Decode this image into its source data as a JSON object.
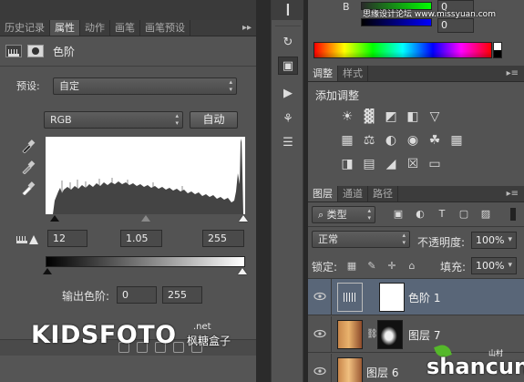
{
  "properties_panel": {
    "tabs": [
      "历史记录",
      "属性",
      "动作",
      "画笔",
      "画笔预设"
    ],
    "active_tab": "属性",
    "tab_overflow": "▸▸",
    "adjustment_title": "色阶",
    "preset_label": "预设:",
    "preset_value": "自定",
    "channel_value": "RGB",
    "auto_button": "自动",
    "input_black": "12",
    "input_gamma": "1.05",
    "input_white": "255",
    "output_label": "输出色阶:",
    "output_black": "0",
    "output_white": "255"
  },
  "color_panel": {
    "row_b_label": "B",
    "row_g_value": "0",
    "row_b_value": "0"
  },
  "adjustments_panel": {
    "tabs": [
      "调整",
      "样式"
    ],
    "title": "添加调整"
  },
  "layers_panel": {
    "tabs": [
      "图层",
      "通道",
      "路径"
    ],
    "filter_kind": "类型",
    "blend_mode": "正常",
    "opacity_label": "不透明度:",
    "opacity_value": "100%",
    "lock_label": "锁定:",
    "fill_label": "填充:",
    "fill_value": "100%",
    "layers": [
      {
        "name": "色阶 1",
        "selected": true
      },
      {
        "name": "图层 7",
        "selected": false
      },
      {
        "name": "图层 6",
        "selected": false
      }
    ]
  },
  "watermarks": {
    "kidsfoto": "KIDSFOTO",
    "kidsfoto_net": ".net",
    "kidsfoto_cn": "枫糖盒子",
    "top_text": "思缘设计论坛 www.missyuan.com",
    "shancun": "shancun",
    "shancun_cn": "山村"
  },
  "colors": {
    "panel_bg": "#535353",
    "tab_bar": "#3c3c3c",
    "selected_layer": "#596678",
    "app_bg": "#282828"
  }
}
